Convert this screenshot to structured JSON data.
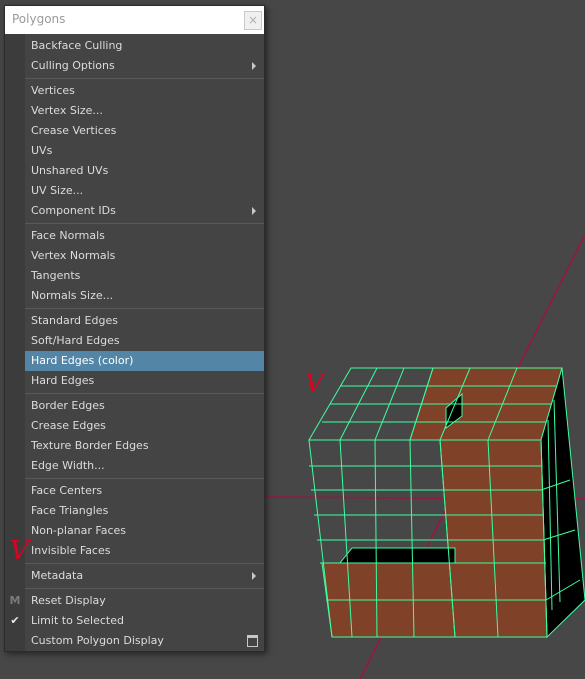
{
  "window": {
    "title": "Polygons",
    "close_glyph": "×"
  },
  "menu": {
    "items": [
      {
        "label": "Backface Culling"
      },
      {
        "label": "Culling Options",
        "submenu": true
      },
      {
        "label": "Vertices"
      },
      {
        "label": "Vertex Size..."
      },
      {
        "label": "Crease Vertices"
      },
      {
        "label": "UVs"
      },
      {
        "label": "Unshared UVs"
      },
      {
        "label": "UV Size..."
      },
      {
        "label": "Component IDs",
        "submenu": true
      },
      {
        "label": "Face Normals"
      },
      {
        "label": "Vertex Normals"
      },
      {
        "label": "Tangents"
      },
      {
        "label": "Normals Size..."
      },
      {
        "label": "Standard Edges"
      },
      {
        "label": "Soft/Hard Edges"
      },
      {
        "label": "Hard Edges (color)",
        "highlighted": true
      },
      {
        "label": "Hard Edges"
      },
      {
        "label": "Border Edges"
      },
      {
        "label": "Crease Edges"
      },
      {
        "label": "Texture Border Edges"
      },
      {
        "label": "Edge Width..."
      },
      {
        "label": "Face Centers"
      },
      {
        "label": "Face Triangles"
      },
      {
        "label": "Non-planar Faces"
      },
      {
        "label": "Invisible Faces"
      },
      {
        "label": "Metadata",
        "submenu": true
      },
      {
        "label": "Reset Display",
        "gutter_icon": "m-icon"
      },
      {
        "label": "Limit to Selected",
        "gutter_icon": "check-icon"
      },
      {
        "label": "Custom Polygon Display",
        "option_box": true
      }
    ],
    "highlight_color": "#5285a6"
  },
  "gutter": {
    "m_glyph": "M",
    "check_glyph": "✔"
  },
  "annotations": {
    "check_mark_glyph": "V"
  },
  "colors": {
    "viewport_bg": "#474747",
    "wireframe": "#3dffa0",
    "face_fill": "#7f4127",
    "axis_line": "#a0143c",
    "annotation": "#e00020"
  }
}
